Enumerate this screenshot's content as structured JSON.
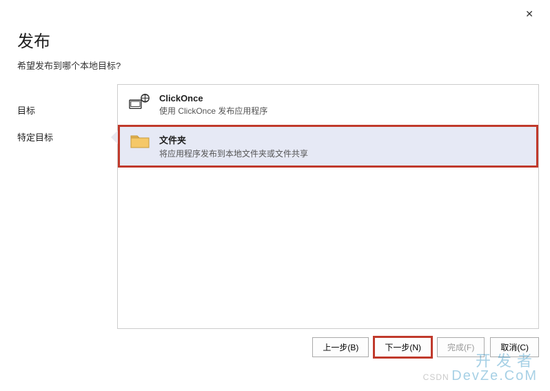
{
  "close_label": "✕",
  "header": {
    "title": "发布",
    "subtitle": "希望发布到哪个本地目标?"
  },
  "sidebar": {
    "items": [
      {
        "label": "目标"
      },
      {
        "label": "特定目标"
      }
    ]
  },
  "options": [
    {
      "title": "ClickOnce",
      "desc": "使用 ClickOnce 发布应用程序"
    },
    {
      "title": "文件夹",
      "desc": "将应用程序发布到本地文件夹或文件共享"
    }
  ],
  "footer": {
    "back": "上一步(B)",
    "next": "下一步(N)",
    "finish": "完成(F)",
    "cancel": "取消(C)"
  },
  "watermark": {
    "line1": "开发者",
    "line2": "DevZe.CoM",
    "csdn": "CSDN"
  }
}
